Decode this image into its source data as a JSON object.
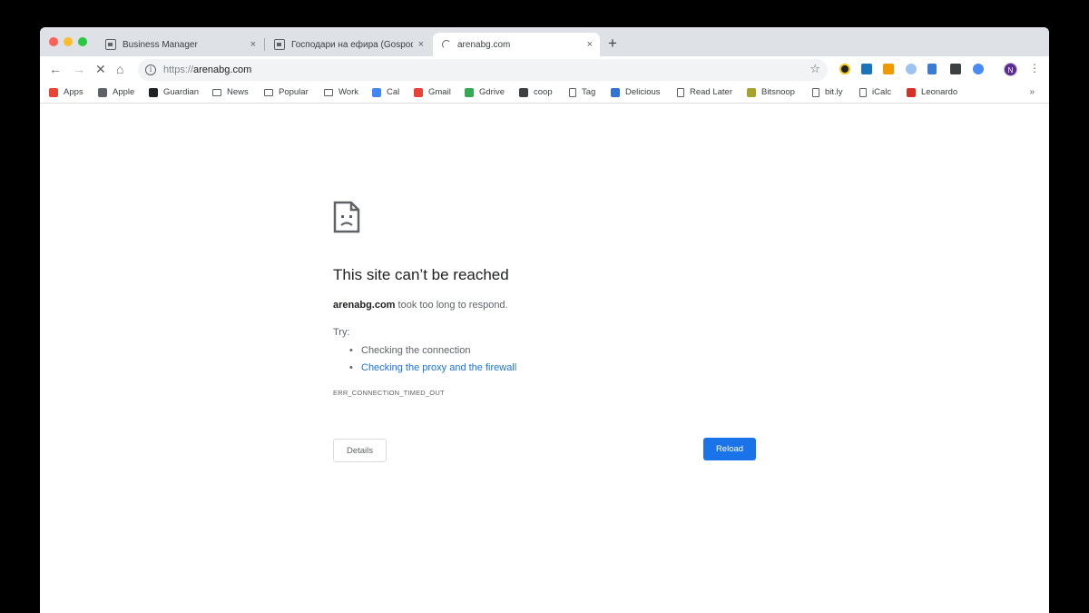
{
  "tabs": [
    {
      "title": "Business Manager",
      "active": false
    },
    {
      "title": "Господари на ефира (Gospod",
      "active": false
    },
    {
      "title": "arenabg.com",
      "active": true
    }
  ],
  "new_tab_label": "+",
  "tab_close_glyph": "×",
  "omnibox": {
    "scheme": "https://",
    "host": "arenabg.com"
  },
  "bookmarks": [
    {
      "label": "Apps",
      "icon": "apps-grid-icon",
      "color": "#ea4335"
    },
    {
      "label": "Apple",
      "icon": "apple-icon",
      "color": "#5f6368"
    },
    {
      "label": "Guardian",
      "icon": "guardian-icon",
      "color": "#202124"
    },
    {
      "label": "News",
      "icon": "folder-icon",
      "color": "#5f6368"
    },
    {
      "label": "Popular",
      "icon": "folder-icon",
      "color": "#5f6368"
    },
    {
      "label": "Work",
      "icon": "folder-icon",
      "color": "#5f6368"
    },
    {
      "label": "Cal",
      "icon": "calendar-icon",
      "color": "#4285f4"
    },
    {
      "label": "Gmail",
      "icon": "gmail-icon",
      "color": "#ea4335"
    },
    {
      "label": "Gdrive",
      "icon": "gdrive-icon",
      "color": "#34a853"
    },
    {
      "label": "coop",
      "icon": "coop-icon",
      "color": "#3c4043"
    },
    {
      "label": "Tag",
      "icon": "page-icon",
      "color": "#5f6368"
    },
    {
      "label": "Delicious",
      "icon": "delicious-icon",
      "color": "#3274d6"
    },
    {
      "label": "Read Later",
      "icon": "page-icon",
      "color": "#5f6368"
    },
    {
      "label": "Bitsnoop",
      "icon": "bitsnoop-icon",
      "color": "#a6a22a"
    },
    {
      "label": "bit.ly",
      "icon": "page-icon",
      "color": "#5f6368"
    },
    {
      "label": "iCalc",
      "icon": "page-icon",
      "color": "#5f6368"
    },
    {
      "label": "Leonardo",
      "icon": "leonardo-icon",
      "color": "#d93025"
    }
  ],
  "bookmarks_more": "»",
  "profile_initial": "N",
  "error": {
    "title": "This site can’t be reached",
    "host": "arenabg.com",
    "message": " took too long to respond.",
    "try_label": "Try:",
    "suggestions": [
      {
        "text": "Checking the connection",
        "link": false
      },
      {
        "text": "Checking the proxy and the firewall",
        "link": true
      }
    ],
    "code": "ERR_CONNECTION_TIMED_OUT",
    "details_button": "Details",
    "reload_button": "Reload"
  }
}
